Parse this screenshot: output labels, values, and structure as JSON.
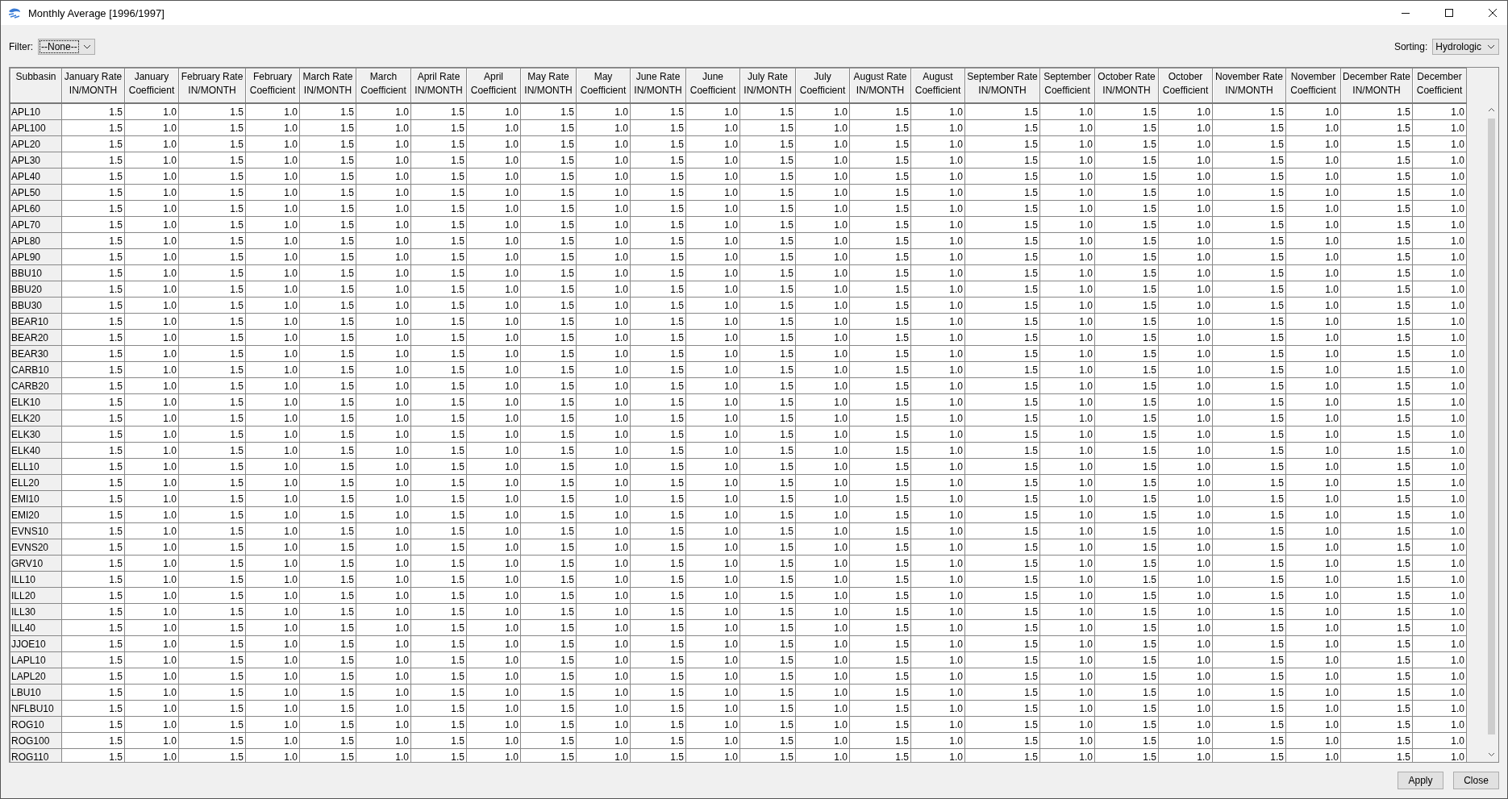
{
  "window": {
    "title": "Monthly Average [1996/1997]"
  },
  "filter": {
    "label": "Filter:",
    "value": "--None--"
  },
  "sorting": {
    "label": "Sorting:",
    "value": "Hydrologic"
  },
  "table": {
    "columns": [
      "Subbasin",
      "January Rate\nIN/MONTH",
      "January\nCoefficient",
      "February Rate\nIN/MONTH",
      "February\nCoefficient",
      "March Rate\nIN/MONTH",
      "March\nCoefficient",
      "April Rate\nIN/MONTH",
      "April\nCoefficient",
      "May Rate\nIN/MONTH",
      "May\nCoefficient",
      "June Rate\nIN/MONTH",
      "June\nCoefficient",
      "July Rate\nIN/MONTH",
      "July\nCoefficient",
      "August Rate\nIN/MONTH",
      "August\nCoefficient",
      "September Rate\nIN/MONTH",
      "September\nCoefficient",
      "October Rate\nIN/MONTH",
      "October\nCoefficient",
      "November Rate\nIN/MONTH",
      "November\nCoefficient",
      "December Rate\nIN/MONTH",
      "December\nCoefficient"
    ],
    "rows": [
      {
        "subbasin": "APL10",
        "values": [
          "1.5",
          "1.0",
          "1.5",
          "1.0",
          "1.5",
          "1.0",
          "1.5",
          "1.0",
          "1.5",
          "1.0",
          "1.5",
          "1.0",
          "1.5",
          "1.0",
          "1.5",
          "1.0",
          "1.5",
          "1.0",
          "1.5",
          "1.0",
          "1.5",
          "1.0",
          "1.5",
          "1.0"
        ]
      },
      {
        "subbasin": "APL100",
        "values": [
          "1.5",
          "1.0",
          "1.5",
          "1.0",
          "1.5",
          "1.0",
          "1.5",
          "1.0",
          "1.5",
          "1.0",
          "1.5",
          "1.0",
          "1.5",
          "1.0",
          "1.5",
          "1.0",
          "1.5",
          "1.0",
          "1.5",
          "1.0",
          "1.5",
          "1.0",
          "1.5",
          "1.0"
        ]
      },
      {
        "subbasin": "APL20",
        "values": [
          "1.5",
          "1.0",
          "1.5",
          "1.0",
          "1.5",
          "1.0",
          "1.5",
          "1.0",
          "1.5",
          "1.0",
          "1.5",
          "1.0",
          "1.5",
          "1.0",
          "1.5",
          "1.0",
          "1.5",
          "1.0",
          "1.5",
          "1.0",
          "1.5",
          "1.0",
          "1.5",
          "1.0"
        ]
      },
      {
        "subbasin": "APL30",
        "values": [
          "1.5",
          "1.0",
          "1.5",
          "1.0",
          "1.5",
          "1.0",
          "1.5",
          "1.0",
          "1.5",
          "1.0",
          "1.5",
          "1.0",
          "1.5",
          "1.0",
          "1.5",
          "1.0",
          "1.5",
          "1.0",
          "1.5",
          "1.0",
          "1.5",
          "1.0",
          "1.5",
          "1.0"
        ]
      },
      {
        "subbasin": "APL40",
        "values": [
          "1.5",
          "1.0",
          "1.5",
          "1.0",
          "1.5",
          "1.0",
          "1.5",
          "1.0",
          "1.5",
          "1.0",
          "1.5",
          "1.0",
          "1.5",
          "1.0",
          "1.5",
          "1.0",
          "1.5",
          "1.0",
          "1.5",
          "1.0",
          "1.5",
          "1.0",
          "1.5",
          "1.0"
        ]
      },
      {
        "subbasin": "APL50",
        "values": [
          "1.5",
          "1.0",
          "1.5",
          "1.0",
          "1.5",
          "1.0",
          "1.5",
          "1.0",
          "1.5",
          "1.0",
          "1.5",
          "1.0",
          "1.5",
          "1.0",
          "1.5",
          "1.0",
          "1.5",
          "1.0",
          "1.5",
          "1.0",
          "1.5",
          "1.0",
          "1.5",
          "1.0"
        ]
      },
      {
        "subbasin": "APL60",
        "values": [
          "1.5",
          "1.0",
          "1.5",
          "1.0",
          "1.5",
          "1.0",
          "1.5",
          "1.0",
          "1.5",
          "1.0",
          "1.5",
          "1.0",
          "1.5",
          "1.0",
          "1.5",
          "1.0",
          "1.5",
          "1.0",
          "1.5",
          "1.0",
          "1.5",
          "1.0",
          "1.5",
          "1.0"
        ]
      },
      {
        "subbasin": "APL70",
        "values": [
          "1.5",
          "1.0",
          "1.5",
          "1.0",
          "1.5",
          "1.0",
          "1.5",
          "1.0",
          "1.5",
          "1.0",
          "1.5",
          "1.0",
          "1.5",
          "1.0",
          "1.5",
          "1.0",
          "1.5",
          "1.0",
          "1.5",
          "1.0",
          "1.5",
          "1.0",
          "1.5",
          "1.0"
        ]
      },
      {
        "subbasin": "APL80",
        "values": [
          "1.5",
          "1.0",
          "1.5",
          "1.0",
          "1.5",
          "1.0",
          "1.5",
          "1.0",
          "1.5",
          "1.0",
          "1.5",
          "1.0",
          "1.5",
          "1.0",
          "1.5",
          "1.0",
          "1.5",
          "1.0",
          "1.5",
          "1.0",
          "1.5",
          "1.0",
          "1.5",
          "1.0"
        ]
      },
      {
        "subbasin": "APL90",
        "values": [
          "1.5",
          "1.0",
          "1.5",
          "1.0",
          "1.5",
          "1.0",
          "1.5",
          "1.0",
          "1.5",
          "1.0",
          "1.5",
          "1.0",
          "1.5",
          "1.0",
          "1.5",
          "1.0",
          "1.5",
          "1.0",
          "1.5",
          "1.0",
          "1.5",
          "1.0",
          "1.5",
          "1.0"
        ]
      },
      {
        "subbasin": "BBU10",
        "values": [
          "1.5",
          "1.0",
          "1.5",
          "1.0",
          "1.5",
          "1.0",
          "1.5",
          "1.0",
          "1.5",
          "1.0",
          "1.5",
          "1.0",
          "1.5",
          "1.0",
          "1.5",
          "1.0",
          "1.5",
          "1.0",
          "1.5",
          "1.0",
          "1.5",
          "1.0",
          "1.5",
          "1.0"
        ]
      },
      {
        "subbasin": "BBU20",
        "values": [
          "1.5",
          "1.0",
          "1.5",
          "1.0",
          "1.5",
          "1.0",
          "1.5",
          "1.0",
          "1.5",
          "1.0",
          "1.5",
          "1.0",
          "1.5",
          "1.0",
          "1.5",
          "1.0",
          "1.5",
          "1.0",
          "1.5",
          "1.0",
          "1.5",
          "1.0",
          "1.5",
          "1.0"
        ]
      },
      {
        "subbasin": "BBU30",
        "values": [
          "1.5",
          "1.0",
          "1.5",
          "1.0",
          "1.5",
          "1.0",
          "1.5",
          "1.0",
          "1.5",
          "1.0",
          "1.5",
          "1.0",
          "1.5",
          "1.0",
          "1.5",
          "1.0",
          "1.5",
          "1.0",
          "1.5",
          "1.0",
          "1.5",
          "1.0",
          "1.5",
          "1.0"
        ]
      },
      {
        "subbasin": "BEAR10",
        "values": [
          "1.5",
          "1.0",
          "1.5",
          "1.0",
          "1.5",
          "1.0",
          "1.5",
          "1.0",
          "1.5",
          "1.0",
          "1.5",
          "1.0",
          "1.5",
          "1.0",
          "1.5",
          "1.0",
          "1.5",
          "1.0",
          "1.5",
          "1.0",
          "1.5",
          "1.0",
          "1.5",
          "1.0"
        ]
      },
      {
        "subbasin": "BEAR20",
        "values": [
          "1.5",
          "1.0",
          "1.5",
          "1.0",
          "1.5",
          "1.0",
          "1.5",
          "1.0",
          "1.5",
          "1.0",
          "1.5",
          "1.0",
          "1.5",
          "1.0",
          "1.5",
          "1.0",
          "1.5",
          "1.0",
          "1.5",
          "1.0",
          "1.5",
          "1.0",
          "1.5",
          "1.0"
        ]
      },
      {
        "subbasin": "BEAR30",
        "values": [
          "1.5",
          "1.0",
          "1.5",
          "1.0",
          "1.5",
          "1.0",
          "1.5",
          "1.0",
          "1.5",
          "1.0",
          "1.5",
          "1.0",
          "1.5",
          "1.0",
          "1.5",
          "1.0",
          "1.5",
          "1.0",
          "1.5",
          "1.0",
          "1.5",
          "1.0",
          "1.5",
          "1.0"
        ]
      },
      {
        "subbasin": "CARB10",
        "values": [
          "1.5",
          "1.0",
          "1.5",
          "1.0",
          "1.5",
          "1.0",
          "1.5",
          "1.0",
          "1.5",
          "1.0",
          "1.5",
          "1.0",
          "1.5",
          "1.0",
          "1.5",
          "1.0",
          "1.5",
          "1.0",
          "1.5",
          "1.0",
          "1.5",
          "1.0",
          "1.5",
          "1.0"
        ]
      },
      {
        "subbasin": "CARB20",
        "values": [
          "1.5",
          "1.0",
          "1.5",
          "1.0",
          "1.5",
          "1.0",
          "1.5",
          "1.0",
          "1.5",
          "1.0",
          "1.5",
          "1.0",
          "1.5",
          "1.0",
          "1.5",
          "1.0",
          "1.5",
          "1.0",
          "1.5",
          "1.0",
          "1.5",
          "1.0",
          "1.5",
          "1.0"
        ]
      },
      {
        "subbasin": "ELK10",
        "values": [
          "1.5",
          "1.0",
          "1.5",
          "1.0",
          "1.5",
          "1.0",
          "1.5",
          "1.0",
          "1.5",
          "1.0",
          "1.5",
          "1.0",
          "1.5",
          "1.0",
          "1.5",
          "1.0",
          "1.5",
          "1.0",
          "1.5",
          "1.0",
          "1.5",
          "1.0",
          "1.5",
          "1.0"
        ]
      },
      {
        "subbasin": "ELK20",
        "values": [
          "1.5",
          "1.0",
          "1.5",
          "1.0",
          "1.5",
          "1.0",
          "1.5",
          "1.0",
          "1.5",
          "1.0",
          "1.5",
          "1.0",
          "1.5",
          "1.0",
          "1.5",
          "1.0",
          "1.5",
          "1.0",
          "1.5",
          "1.0",
          "1.5",
          "1.0",
          "1.5",
          "1.0"
        ]
      },
      {
        "subbasin": "ELK30",
        "values": [
          "1.5",
          "1.0",
          "1.5",
          "1.0",
          "1.5",
          "1.0",
          "1.5",
          "1.0",
          "1.5",
          "1.0",
          "1.5",
          "1.0",
          "1.5",
          "1.0",
          "1.5",
          "1.0",
          "1.5",
          "1.0",
          "1.5",
          "1.0",
          "1.5",
          "1.0",
          "1.5",
          "1.0"
        ]
      },
      {
        "subbasin": "ELK40",
        "values": [
          "1.5",
          "1.0",
          "1.5",
          "1.0",
          "1.5",
          "1.0",
          "1.5",
          "1.0",
          "1.5",
          "1.0",
          "1.5",
          "1.0",
          "1.5",
          "1.0",
          "1.5",
          "1.0",
          "1.5",
          "1.0",
          "1.5",
          "1.0",
          "1.5",
          "1.0",
          "1.5",
          "1.0"
        ]
      },
      {
        "subbasin": "ELL10",
        "values": [
          "1.5",
          "1.0",
          "1.5",
          "1.0",
          "1.5",
          "1.0",
          "1.5",
          "1.0",
          "1.5",
          "1.0",
          "1.5",
          "1.0",
          "1.5",
          "1.0",
          "1.5",
          "1.0",
          "1.5",
          "1.0",
          "1.5",
          "1.0",
          "1.5",
          "1.0",
          "1.5",
          "1.0"
        ]
      },
      {
        "subbasin": "ELL20",
        "values": [
          "1.5",
          "1.0",
          "1.5",
          "1.0",
          "1.5",
          "1.0",
          "1.5",
          "1.0",
          "1.5",
          "1.0",
          "1.5",
          "1.0",
          "1.5",
          "1.0",
          "1.5",
          "1.0",
          "1.5",
          "1.0",
          "1.5",
          "1.0",
          "1.5",
          "1.0",
          "1.5",
          "1.0"
        ]
      },
      {
        "subbasin": "EMI10",
        "values": [
          "1.5",
          "1.0",
          "1.5",
          "1.0",
          "1.5",
          "1.0",
          "1.5",
          "1.0",
          "1.5",
          "1.0",
          "1.5",
          "1.0",
          "1.5",
          "1.0",
          "1.5",
          "1.0",
          "1.5",
          "1.0",
          "1.5",
          "1.0",
          "1.5",
          "1.0",
          "1.5",
          "1.0"
        ]
      },
      {
        "subbasin": "EMI20",
        "values": [
          "1.5",
          "1.0",
          "1.5",
          "1.0",
          "1.5",
          "1.0",
          "1.5",
          "1.0",
          "1.5",
          "1.0",
          "1.5",
          "1.0",
          "1.5",
          "1.0",
          "1.5",
          "1.0",
          "1.5",
          "1.0",
          "1.5",
          "1.0",
          "1.5",
          "1.0",
          "1.5",
          "1.0"
        ]
      },
      {
        "subbasin": "EVNS10",
        "values": [
          "1.5",
          "1.0",
          "1.5",
          "1.0",
          "1.5",
          "1.0",
          "1.5",
          "1.0",
          "1.5",
          "1.0",
          "1.5",
          "1.0",
          "1.5",
          "1.0",
          "1.5",
          "1.0",
          "1.5",
          "1.0",
          "1.5",
          "1.0",
          "1.5",
          "1.0",
          "1.5",
          "1.0"
        ]
      },
      {
        "subbasin": "EVNS20",
        "values": [
          "1.5",
          "1.0",
          "1.5",
          "1.0",
          "1.5",
          "1.0",
          "1.5",
          "1.0",
          "1.5",
          "1.0",
          "1.5",
          "1.0",
          "1.5",
          "1.0",
          "1.5",
          "1.0",
          "1.5",
          "1.0",
          "1.5",
          "1.0",
          "1.5",
          "1.0",
          "1.5",
          "1.0"
        ]
      },
      {
        "subbasin": "GRV10",
        "values": [
          "1.5",
          "1.0",
          "1.5",
          "1.0",
          "1.5",
          "1.0",
          "1.5",
          "1.0",
          "1.5",
          "1.0",
          "1.5",
          "1.0",
          "1.5",
          "1.0",
          "1.5",
          "1.0",
          "1.5",
          "1.0",
          "1.5",
          "1.0",
          "1.5",
          "1.0",
          "1.5",
          "1.0"
        ]
      },
      {
        "subbasin": "ILL10",
        "values": [
          "1.5",
          "1.0",
          "1.5",
          "1.0",
          "1.5",
          "1.0",
          "1.5",
          "1.0",
          "1.5",
          "1.0",
          "1.5",
          "1.0",
          "1.5",
          "1.0",
          "1.5",
          "1.0",
          "1.5",
          "1.0",
          "1.5",
          "1.0",
          "1.5",
          "1.0",
          "1.5",
          "1.0"
        ]
      },
      {
        "subbasin": "ILL20",
        "values": [
          "1.5",
          "1.0",
          "1.5",
          "1.0",
          "1.5",
          "1.0",
          "1.5",
          "1.0",
          "1.5",
          "1.0",
          "1.5",
          "1.0",
          "1.5",
          "1.0",
          "1.5",
          "1.0",
          "1.5",
          "1.0",
          "1.5",
          "1.0",
          "1.5",
          "1.0",
          "1.5",
          "1.0"
        ]
      },
      {
        "subbasin": "ILL30",
        "values": [
          "1.5",
          "1.0",
          "1.5",
          "1.0",
          "1.5",
          "1.0",
          "1.5",
          "1.0",
          "1.5",
          "1.0",
          "1.5",
          "1.0",
          "1.5",
          "1.0",
          "1.5",
          "1.0",
          "1.5",
          "1.0",
          "1.5",
          "1.0",
          "1.5",
          "1.0",
          "1.5",
          "1.0"
        ]
      },
      {
        "subbasin": "ILL40",
        "values": [
          "1.5",
          "1.0",
          "1.5",
          "1.0",
          "1.5",
          "1.0",
          "1.5",
          "1.0",
          "1.5",
          "1.0",
          "1.5",
          "1.0",
          "1.5",
          "1.0",
          "1.5",
          "1.0",
          "1.5",
          "1.0",
          "1.5",
          "1.0",
          "1.5",
          "1.0",
          "1.5",
          "1.0"
        ]
      },
      {
        "subbasin": "JJOE10",
        "values": [
          "1.5",
          "1.0",
          "1.5",
          "1.0",
          "1.5",
          "1.0",
          "1.5",
          "1.0",
          "1.5",
          "1.0",
          "1.5",
          "1.0",
          "1.5",
          "1.0",
          "1.5",
          "1.0",
          "1.5",
          "1.0",
          "1.5",
          "1.0",
          "1.5",
          "1.0",
          "1.5",
          "1.0"
        ]
      },
      {
        "subbasin": "LAPL10",
        "values": [
          "1.5",
          "1.0",
          "1.5",
          "1.0",
          "1.5",
          "1.0",
          "1.5",
          "1.0",
          "1.5",
          "1.0",
          "1.5",
          "1.0",
          "1.5",
          "1.0",
          "1.5",
          "1.0",
          "1.5",
          "1.0",
          "1.5",
          "1.0",
          "1.5",
          "1.0",
          "1.5",
          "1.0"
        ]
      },
      {
        "subbasin": "LAPL20",
        "values": [
          "1.5",
          "1.0",
          "1.5",
          "1.0",
          "1.5",
          "1.0",
          "1.5",
          "1.0",
          "1.5",
          "1.0",
          "1.5",
          "1.0",
          "1.5",
          "1.0",
          "1.5",
          "1.0",
          "1.5",
          "1.0",
          "1.5",
          "1.0",
          "1.5",
          "1.0",
          "1.5",
          "1.0"
        ]
      },
      {
        "subbasin": "LBU10",
        "values": [
          "1.5",
          "1.0",
          "1.5",
          "1.0",
          "1.5",
          "1.0",
          "1.5",
          "1.0",
          "1.5",
          "1.0",
          "1.5",
          "1.0",
          "1.5",
          "1.0",
          "1.5",
          "1.0",
          "1.5",
          "1.0",
          "1.5",
          "1.0",
          "1.5",
          "1.0",
          "1.5",
          "1.0"
        ]
      },
      {
        "subbasin": "NFLBU10",
        "values": [
          "1.5",
          "1.0",
          "1.5",
          "1.0",
          "1.5",
          "1.0",
          "1.5",
          "1.0",
          "1.5",
          "1.0",
          "1.5",
          "1.0",
          "1.5",
          "1.0",
          "1.5",
          "1.0",
          "1.5",
          "1.0",
          "1.5",
          "1.0",
          "1.5",
          "1.0",
          "1.5",
          "1.0"
        ]
      },
      {
        "subbasin": "ROG10",
        "values": [
          "1.5",
          "1.0",
          "1.5",
          "1.0",
          "1.5",
          "1.0",
          "1.5",
          "1.0",
          "1.5",
          "1.0",
          "1.5",
          "1.0",
          "1.5",
          "1.0",
          "1.5",
          "1.0",
          "1.5",
          "1.0",
          "1.5",
          "1.0",
          "1.5",
          "1.0",
          "1.5",
          "1.0"
        ]
      },
      {
        "subbasin": "ROG100",
        "values": [
          "1.5",
          "1.0",
          "1.5",
          "1.0",
          "1.5",
          "1.0",
          "1.5",
          "1.0",
          "1.5",
          "1.0",
          "1.5",
          "1.0",
          "1.5",
          "1.0",
          "1.5",
          "1.0",
          "1.5",
          "1.0",
          "1.5",
          "1.0",
          "1.5",
          "1.0",
          "1.5",
          "1.0"
        ]
      },
      {
        "subbasin": "ROG110",
        "values": [
          "1.5",
          "1.0",
          "1.5",
          "1.0",
          "1.5",
          "1.0",
          "1.5",
          "1.0",
          "1.5",
          "1.0",
          "1.5",
          "1.0",
          "1.5",
          "1.0",
          "1.5",
          "1.0",
          "1.5",
          "1.0",
          "1.5",
          "1.0",
          "1.5",
          "1.0",
          "1.5",
          "1.0"
        ]
      }
    ]
  },
  "buttons": [
    "Apply",
    "Close"
  ]
}
